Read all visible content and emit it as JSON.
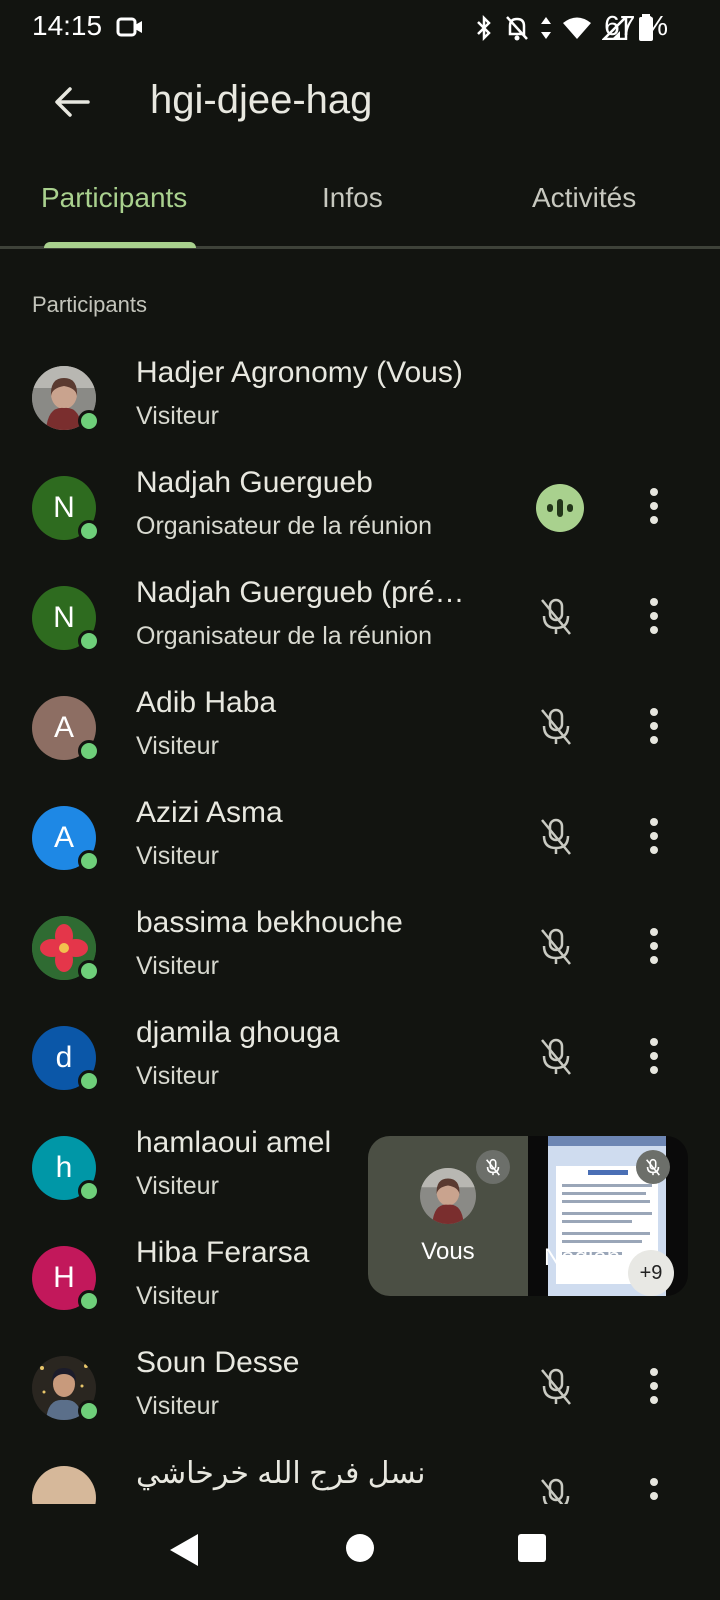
{
  "status_bar": {
    "time": "14:15",
    "battery_percent": "67 %",
    "icons": [
      "video-record-icon",
      "bluetooth-icon",
      "notifications-off-icon",
      "data-arrows-icon",
      "wifi-icon",
      "signal-icon",
      "battery-icon"
    ]
  },
  "header": {
    "title": "hgi-djee-hag"
  },
  "tabs": [
    {
      "label": "Participants",
      "active": true
    },
    {
      "label": "Infos",
      "active": false
    },
    {
      "label": "Activités",
      "active": false
    }
  ],
  "section_label": "Participants",
  "participants": [
    {
      "name": "Hadjer Agronomy (Vous)",
      "role": "Visiteur",
      "avatar": "photo",
      "mic": "none"
    },
    {
      "name": "Nadjah Guergueb",
      "role": "Organisateur de la réunion",
      "initial": "N",
      "avatar_color": "#2e6b1f",
      "mic": "speaking"
    },
    {
      "name": "Nadjah Guergueb (pré…",
      "role": "Organisateur de la réunion",
      "initial": "N",
      "avatar_color": "#2e6b1f",
      "mic": "muted"
    },
    {
      "name": "Adib Haba",
      "role": "Visiteur",
      "initial": "A",
      "avatar_color": "#8d6e63",
      "mic": "muted"
    },
    {
      "name": "Azizi Asma",
      "role": "Visiteur",
      "initial": "A",
      "avatar_color": "#1e88e5",
      "mic": "muted"
    },
    {
      "name": "bassima bekhouche",
      "role": "Visiteur",
      "avatar": "flower-photo",
      "mic": "muted"
    },
    {
      "name": "djamila ghouga",
      "role": "Visiteur",
      "initial": "d",
      "avatar_color": "#0b57a8",
      "mic": "muted"
    },
    {
      "name": "hamlaoui amel",
      "role": "Visiteur",
      "initial": "h",
      "avatar_color": "#0097a7",
      "mic": "muted"
    },
    {
      "name": "Hiba Ferarsa",
      "role": "Visiteur",
      "initial": "H",
      "avatar_color": "#c2185b",
      "mic": "muted"
    },
    {
      "name": "Soun Desse",
      "role": "Visiteur",
      "avatar": "photo",
      "mic": "muted"
    },
    {
      "name": "نسل فرج الله خرخاشي",
      "role": "",
      "avatar": "photo",
      "mic": "muted"
    }
  ],
  "pip": {
    "self_label": "Vous",
    "other_label": "Nadjah",
    "more_count": "+9"
  },
  "nav_bar": {
    "icons": [
      "back-triangle-icon",
      "home-circle-icon",
      "recents-square-icon"
    ]
  },
  "colors": {
    "background": "#121410",
    "accent": "#a9d18e",
    "online": "#6fcf7a"
  }
}
